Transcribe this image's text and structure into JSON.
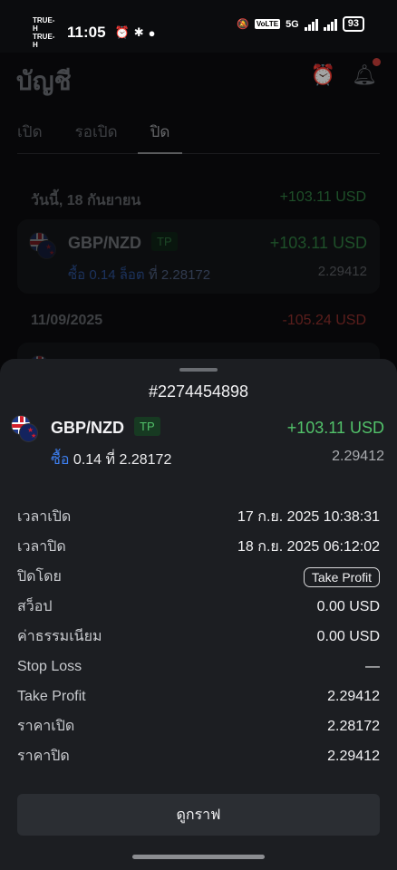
{
  "status_bar": {
    "carrier_1": "TRUE-H",
    "carrier_2": "TRUE-H",
    "time": "11:05",
    "volte": "VoLTE",
    "network": "5G",
    "battery": "93"
  },
  "header": {
    "title": "บัญชี",
    "icons": [
      "alarm-clock-icon",
      "bell-icon"
    ]
  },
  "tabs": [
    {
      "label": "เปิด"
    },
    {
      "label": "รอเปิด"
    },
    {
      "label": "ปิด",
      "active": true
    }
  ],
  "history": [
    {
      "date": "วันนี้, 18 กันยายน",
      "total": "+103.11 USD",
      "trade": {
        "symbol": "GBP/NZD",
        "badge": "TP",
        "pnl": "+103.11 USD",
        "side": "ซื้อ 0.14 ล็อต",
        "at": "ที่ 2.28172",
        "price": "2.29412"
      }
    },
    {
      "date": "11/09/2025",
      "total": "-105.24 USD"
    }
  ],
  "sheet": {
    "order_id": "#2274454898",
    "symbol": "GBP/NZD",
    "badge": "TP",
    "pnl": "+103.11 USD",
    "side": "ซื้อ",
    "volume_at": "0.14 ที่ 2.28172",
    "current_price": "2.29412",
    "details": [
      {
        "label": "เวลาเปิด",
        "value": "17 ก.ย. 2025 10:38:31"
      },
      {
        "label": "เวลาปิด",
        "value": "18 ก.ย. 2025 06:12:02"
      },
      {
        "label": "ปิดโดย",
        "value": "Take Profit"
      },
      {
        "label": "สว็อป",
        "value": "0.00 USD"
      },
      {
        "label": "ค่าธรรมเนียม",
        "value": "0.00 USD"
      },
      {
        "label": "Stop Loss",
        "value": "—"
      },
      {
        "label": "Take Profit",
        "value": "2.29412"
      },
      {
        "label": "ราคาเปิด",
        "value": "2.28172"
      },
      {
        "label": "ราคาปิด",
        "value": "2.29412"
      }
    ],
    "chart_button": "ดูกราฟ"
  },
  "colors": {
    "profit": "#52c26a",
    "loss": "#d8423c",
    "buy": "#3d7ff0",
    "sheet_bg": "#1c1e22"
  }
}
